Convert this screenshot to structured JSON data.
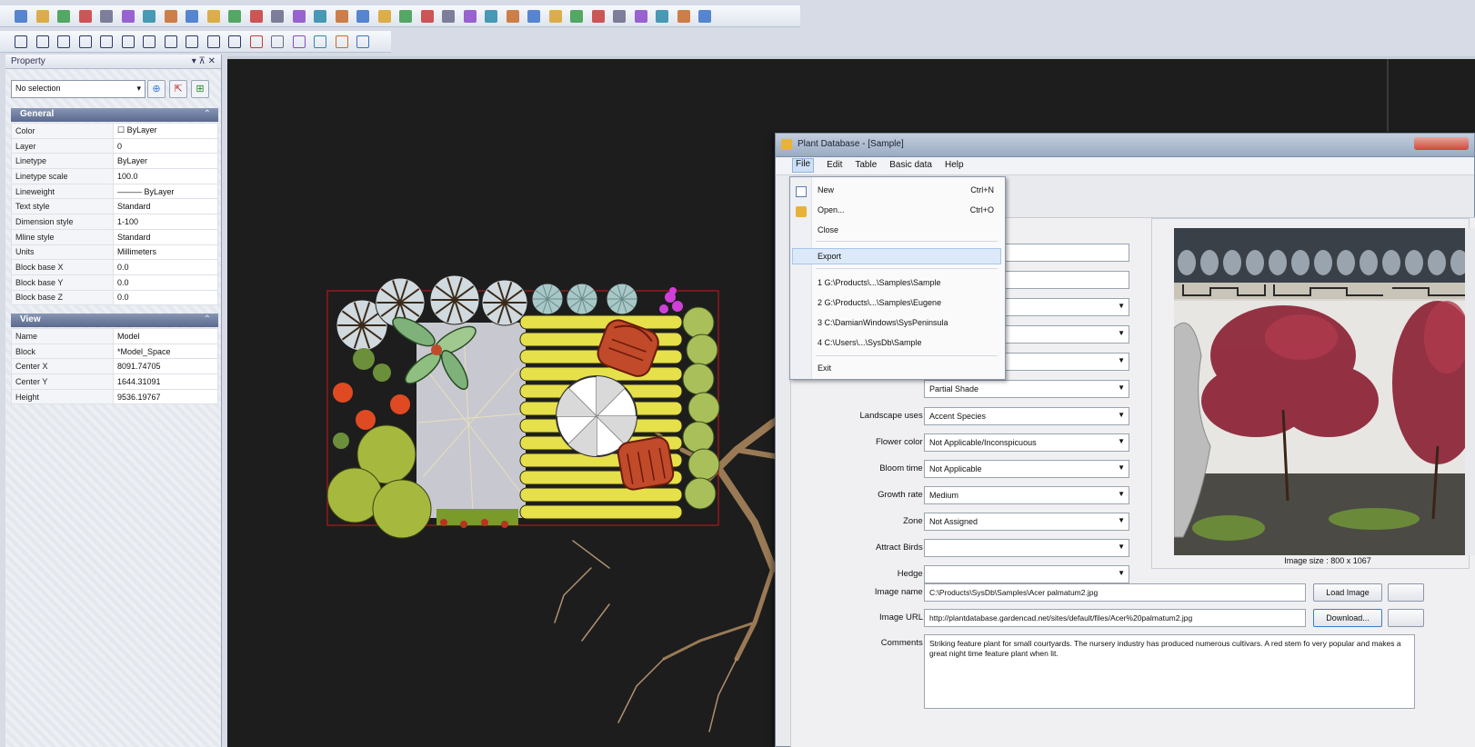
{
  "toolbars": {
    "row1_icons": [
      "new-icon",
      "open-icon",
      "open-folder-icon",
      "save-icon",
      "print-icon",
      "cut-icon",
      "copy-icon",
      "paste-icon",
      "undo-icon",
      "redo-icon",
      "zoom-in-icon",
      "zoom-out-icon",
      "zoom-window-icon",
      "zoom-extents-icon",
      "zoom-all-icon",
      "zoom-previous-icon",
      "pan-icon",
      "grid-icon",
      "ortho-icon",
      "snap-icon",
      "layer-icon",
      "layer-properties-icon",
      "help-icon",
      "plant-icon",
      "table-icon",
      "list-icon",
      "columns-icon",
      "chart-icon",
      "text-style-icon",
      "image-icon",
      "database-icon",
      "export-icon",
      "render-icon"
    ],
    "row2_icons": [
      "point-icon",
      "line-icon",
      "polyline-icon",
      "arc-icon",
      "curve-icon",
      "spline-icon",
      "polygon-icon",
      "rectangle-icon",
      "circle-icon",
      "arc-tool-icon",
      "ellipse-icon",
      "text-icon",
      "hatch-icon",
      "block-icon",
      "insert-icon",
      "dimension-icon",
      "move-icon"
    ]
  },
  "property_panel": {
    "title": "Property",
    "title_controls": "▾ ⊼ ✕",
    "selection_value": "No selection",
    "general": {
      "heading": "General",
      "rows": [
        {
          "label": "Color",
          "value": "☐ ByLayer"
        },
        {
          "label": "Layer",
          "value": "0"
        },
        {
          "label": "Linetype",
          "value": "ByLayer"
        },
        {
          "label": "Linetype scale",
          "value": "100.0"
        },
        {
          "label": "Lineweight",
          "value": "——— ByLayer"
        },
        {
          "label": "Text style",
          "value": "Standard"
        },
        {
          "label": "Dimension style",
          "value": "1-100"
        },
        {
          "label": "Mline style",
          "value": "Standard"
        },
        {
          "label": "Units",
          "value": "Millimeters"
        },
        {
          "label": "Block base X",
          "value": "0.0"
        },
        {
          "label": "Block base Y",
          "value": "0.0"
        },
        {
          "label": "Block base Z",
          "value": "0.0"
        }
      ]
    },
    "view": {
      "heading": "View",
      "rows": [
        {
          "label": "Name",
          "value": "Model"
        },
        {
          "label": "Block",
          "value": "*Model_Space"
        },
        {
          "label": "Center X",
          "value": "8091.74705"
        },
        {
          "label": "Center Y",
          "value": "1644.31091"
        },
        {
          "label": "Height",
          "value": "9536.19767"
        }
      ]
    }
  },
  "dialog": {
    "title": "Plant Database - [Sample]",
    "menu": [
      "File",
      "Edit",
      "Table",
      "Basic data",
      "Help"
    ],
    "fields": [
      {
        "label": "",
        "value": ""
      },
      {
        "label": "Landscape uses :",
        "value": "Accent Species"
      },
      {
        "label": "Flower color :",
        "value": "Not Applicable/Inconspicuous"
      },
      {
        "label": "Bloom time :",
        "value": "Not Applicable"
      },
      {
        "label": "Growth rate :",
        "value": "Medium"
      },
      {
        "label": "Zone :",
        "value": "Not Assigned"
      },
      {
        "label": "Attract Birds :",
        "value": ""
      },
      {
        "label": "Hedge :",
        "value": ""
      }
    ],
    "partial_field_value": "Partial Shade",
    "image_name_label": "Image name :",
    "image_name": "C:\\Products\\SysDb\\Samples\\Acer palmatum2.jpg",
    "image_url_label": "Image URL :",
    "image_url": "http://plantdatabase.gardencad.net/sites/default/files/Acer%20palmatum2.jpg",
    "load_image_button": "Load Image",
    "download_button": "Download...",
    "comments_label": "Comments :",
    "comments": "Striking feature plant for small courtyards. The nursery industry has produced numerous cultivars. A red stem fo very popular and makes a great night time feature plant when lit.",
    "image_size": "Image size : 800 x 1067"
  },
  "file_menu": {
    "items": [
      {
        "label": "New",
        "shortcut": "Ctrl+N"
      },
      {
        "label": "Open...",
        "shortcut": "Ctrl+O"
      },
      {
        "label": "Close",
        "shortcut": ""
      },
      {
        "label": "Export",
        "shortcut": ""
      },
      {
        "label": "1 G:\\Products\\...\\Samples\\Sample",
        "shortcut": ""
      },
      {
        "label": "2 G:\\Products\\...\\Samples\\Eugene",
        "shortcut": ""
      },
      {
        "label": "3 C:\\DamianWindows\\SysPeninsula",
        "shortcut": ""
      },
      {
        "label": "4 C:\\Users\\...\\SysDb\\Sample",
        "shortcut": ""
      },
      {
        "label": "Exit",
        "shortcut": ""
      }
    ]
  },
  "colors": {
    "canvas": "#1d1d1d",
    "deck_yellow": "#e6e04a",
    "boundary_red": "#b01818",
    "shrub_green": "#a7b83e",
    "root_brown": "#9a7a55",
    "accent_blue": "#5a6a8e"
  }
}
